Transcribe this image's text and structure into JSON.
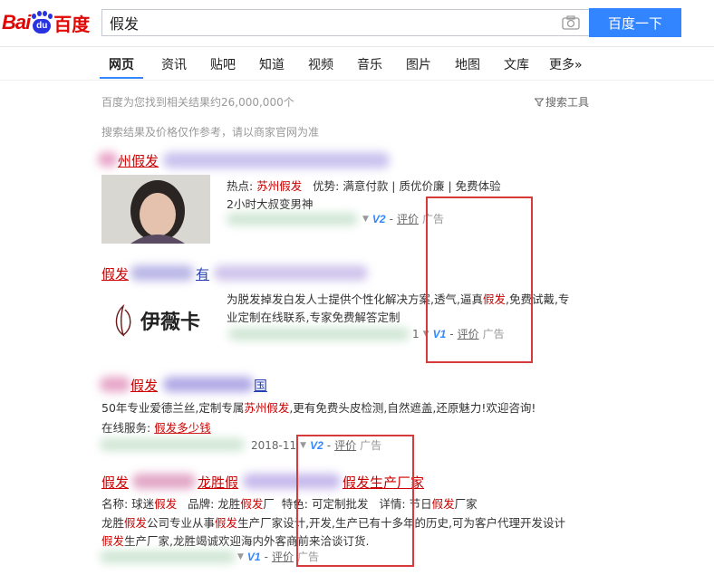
{
  "header": {
    "logo_bai": "Bai",
    "logo_du": "du",
    "logo_cn": "百度",
    "search_value": "假发",
    "search_button": "百度一下"
  },
  "tabs": [
    "网页",
    "资讯",
    "贴吧",
    "知道",
    "视频",
    "音乐",
    "图片",
    "地图",
    "文库",
    "更多»"
  ],
  "result_stats": "百度为您找到相关结果约26,000,000个",
  "search_tools": "搜索工具",
  "price_notice": "搜索结果及价格仅作参考，请以商家官网为准",
  "results": [
    {
      "title_visible": "州假发",
      "hot_label": "热点:",
      "hot_value": "苏州假发",
      "advantage": "优势: 满意付款 | 质优价廉 | 免费体验",
      "sub": "2小时大叔变男神",
      "v_badge": "V2",
      "sep": "-",
      "review": "评价",
      "ad": "广告"
    },
    {
      "title_visible": "假发",
      "title_mid": "有",
      "desc1_pre": "为脱发掉发白发人士提供个性化解决方案,透气,逼真",
      "desc1_red": "假发",
      "desc1_post": ",免费试戴,专",
      "desc2": "业定制在线联系,专家免费解答定制",
      "logo_text": "伊薇卡",
      "url_tail": "1",
      "v_badge": "V1",
      "sep": "-",
      "review": "评价",
      "ad": "广告"
    },
    {
      "title_visible": "假发",
      "title_end": "国",
      "desc_pre": "50年专业爱德兰丝,定制专属",
      "desc_red": "苏州假发",
      "desc_post": ",更有免费头皮检测,自然遮盖,还原魅力!欢迎咨询!",
      "service_label": "在线服务:",
      "service_link": "假发多少钱",
      "date": "2018-11",
      "v_badge": "V2",
      "sep": "-",
      "review": "评价",
      "ad": "广告"
    },
    {
      "title_a": "假发",
      "title_b": "生产厂家",
      "title_c": "龙胜假",
      "title_d": "假发生产厂家",
      "line1_a": "名称: 球迷",
      "line1_red": "假发",
      "line1_b": "品牌: 龙胜",
      "line1_red2": "假发",
      "line1_c": "厂",
      "line1_d": "特色: 可定制批发",
      "line1_e": "详情: 节日",
      "line1_red3": "假发",
      "line1_f": "厂家",
      "line2_a": "龙胜",
      "line2_red": "假发",
      "line2_b": "公司专业从事",
      "line2_red2": "假发",
      "line2_c": "生产厂家设计,开发,生产已有十多年的历史,可为客户代理开发设计",
      "line3_red": "假发",
      "line3_b": "生产厂家,龙胜竭诚欢迎海内外客商前来洽谈订货.",
      "v_badge": "V1",
      "sep": "-",
      "review": "评价",
      "ad": "广告"
    }
  ]
}
